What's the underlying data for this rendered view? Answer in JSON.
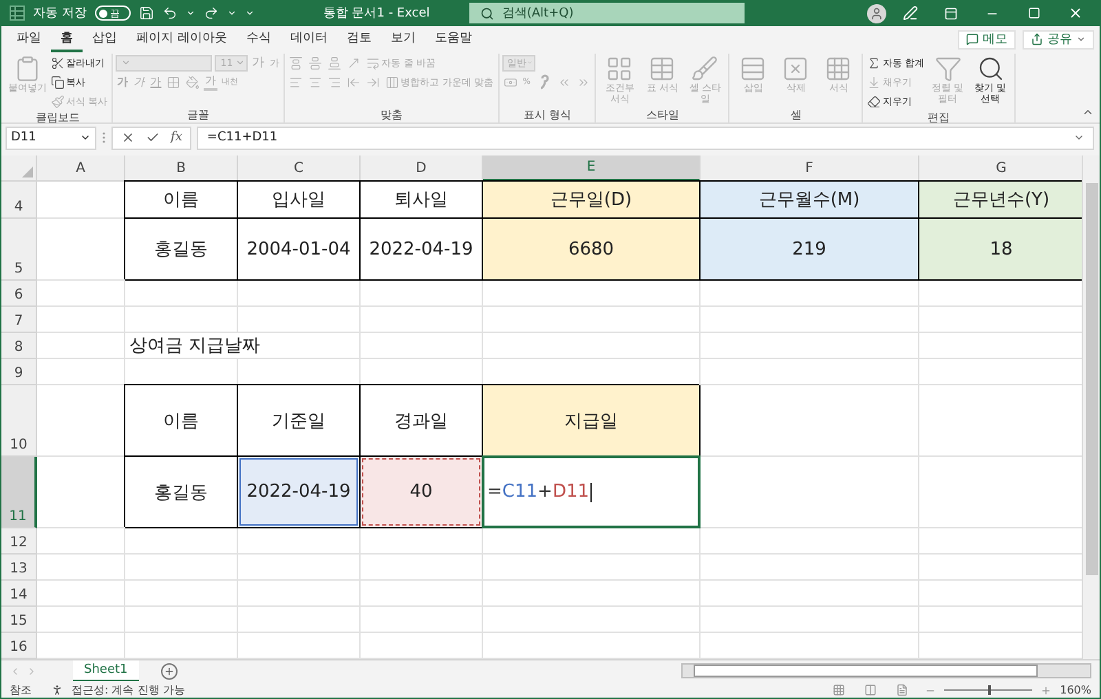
{
  "title_bar": {
    "autosave_label": "자동 저장",
    "autosave": {
      "on": false,
      "label": "끔"
    },
    "title": "통합 문서1  -  Excel",
    "search": {
      "placeholder": "검색(Alt+Q)"
    }
  },
  "ribbon_tabs": [
    {
      "label": "파일",
      "selected": false
    },
    {
      "label": "홈",
      "selected": true
    },
    {
      "label": "삽입",
      "selected": false
    },
    {
      "label": "페이지 레이아웃",
      "selected": false
    },
    {
      "label": "수식",
      "selected": false
    },
    {
      "label": "데이터",
      "selected": false
    },
    {
      "label": "검토",
      "selected": false
    },
    {
      "label": "보기",
      "selected": false
    },
    {
      "label": "도움말",
      "selected": false
    }
  ],
  "ribbon_actions": [
    {
      "label": "메모"
    },
    {
      "label": "공유"
    }
  ],
  "ribbon_groups": [
    {
      "label": "클립보드",
      "blocks": [
        {
          "kind": "large",
          "label": "붙여넣기",
          "disabled": true
        },
        {
          "kind": "stack",
          "lines": [
            [
              {
                "kind": "small",
                "label": "잘라내기",
                "disabled": false
              }
            ],
            [
              {
                "kind": "small",
                "label": "복사",
                "disabled": false
              }
            ],
            [
              {
                "kind": "small",
                "label": "서식 복사",
                "disabled": true
              }
            ]
          ]
        }
      ]
    },
    {
      "label": "글꼴",
      "blocks": [
        {
          "kind": "stack",
          "lines": [
            [
              {
                "kind": "combo",
                "disabled": true
              },
              {
                "kind": "combo",
                "label": "11",
                "disabled": true
              },
              {
                "kind": "grow",
                "label": "가",
                "disabled": true
              },
              {
                "kind": "shrink",
                "label": "가",
                "disabled": true
              }
            ],
            [
              {
                "kind": "bold",
                "label": "가",
                "disabled": true
              },
              {
                "kind": "italic",
                "label": "가",
                "disabled": true
              },
              {
                "kind": "underline",
                "label": "가",
                "disabled": true
              },
              {
                "kind": "small",
                "disabled": true
              },
              {
                "kind": "small",
                "disabled": true
              },
              {
                "kind": "font-color",
                "label": "가",
                "disabled": true
              },
              {
                "kind": "glyph",
                "label": "내천",
                "disabled": true
              }
            ]
          ]
        }
      ]
    },
    {
      "label": "맞춤",
      "blocks": [
        {
          "kind": "stack",
          "lines": [
            [
              {
                "kind": "small",
                "disabled": true
              },
              {
                "kind": "small",
                "disabled": true
              },
              {
                "kind": "small",
                "disabled": true
              },
              {
                "kind": "small",
                "disabled": true
              },
              {
                "kind": "small",
                "label": "자동 줄 바꿈",
                "disabled": true
              }
            ],
            [
              {
                "kind": "small",
                "disabled": true
              },
              {
                "kind": "small",
                "disabled": true
              },
              {
                "kind": "small",
                "disabled": true
              },
              {
                "kind": "small",
                "disabled": true
              },
              {
                "kind": "small",
                "disabled": true
              },
              {
                "kind": "small",
                "label": "병합하고 가운데 맞춤",
                "disabled": true
              }
            ]
          ]
        }
      ]
    },
    {
      "label": "표시 형식",
      "blocks": [
        {
          "kind": "stack",
          "lines": [
            [
              {
                "kind": "combo",
                "label": "일반",
                "disabled": true
              }
            ],
            [
              {
                "kind": "small",
                "disabled": true
              },
              {
                "kind": "glyph",
                "label": "%",
                "disabled": true
              },
              {
                "kind": "small",
                "disabled": true
              },
              {
                "kind": "small",
                "disabled": true
              },
              {
                "kind": "small",
                "disabled": true
              }
            ]
          ]
        }
      ]
    },
    {
      "label": "스타일",
      "blocks": [
        {
          "kind": "large",
          "label": "조건부 서식",
          "disabled": true
        },
        {
          "kind": "large",
          "label": "표 서식",
          "disabled": true
        },
        {
          "kind": "large",
          "label": "셀 스타일",
          "disabled": true
        }
      ]
    },
    {
      "label": "셀",
      "blocks": [
        {
          "kind": "large",
          "label": "삽입",
          "disabled": true
        },
        {
          "kind": "large",
          "label": "삭제",
          "disabled": true
        },
        {
          "kind": "large",
          "label": "서식",
          "disabled": true
        }
      ]
    },
    {
      "label": "편집",
      "blocks": [
        {
          "kind": "stack",
          "lines": [
            [
              {
                "kind": "small",
                "label": "자동 합계",
                "disabled": false
              }
            ],
            [
              {
                "kind": "small",
                "label": "채우기",
                "disabled": true
              }
            ],
            [
              {
                "kind": "small",
                "label": "지우기",
                "disabled": false
              }
            ]
          ]
        },
        {
          "kind": "large",
          "label": "정렬 및 필터",
          "disabled": true
        },
        {
          "kind": "large",
          "label": "찾기 및 선택",
          "disabled": false
        }
      ]
    }
  ],
  "formula_bar": {
    "name_box": "D11",
    "function_button": "fx",
    "formula": "=C11+D11"
  },
  "sheet": {
    "columns": [
      {
        "label": "A",
        "selected": false
      },
      {
        "label": "B",
        "selected": false
      },
      {
        "label": "C",
        "selected": false
      },
      {
        "label": "D",
        "selected": false
      },
      {
        "label": "E",
        "selected": true
      },
      {
        "label": "F",
        "selected": false
      },
      {
        "label": "G",
        "selected": false
      }
    ],
    "rows": [
      {
        "label": "4",
        "kind": "clipped",
        "selected": false,
        "cells": [
          {},
          {
            "text": "이름",
            "bordered": true
          },
          {
            "text": "입사일",
            "bordered": true
          },
          {
            "text": "퇴사일",
            "bordered": true
          },
          {
            "text": "근무일(D)",
            "bordered": true,
            "color": "#fff2cc"
          },
          {
            "text": "근무월수(M)",
            "bordered": true,
            "color": "#ddebf7"
          },
          {
            "text": "근무년수(Y)",
            "bordered": true,
            "color": "#e2efda"
          }
        ]
      },
      {
        "label": "5",
        "kind": "medium",
        "selected": false,
        "cells": [
          {},
          {
            "text": "홍길동",
            "bordered": true
          },
          {
            "text": "2004-01-04",
            "bordered": true
          },
          {
            "text": "2022-04-19",
            "bordered": true
          },
          {
            "text": "6680",
            "bordered": true,
            "color": "#fff2cc"
          },
          {
            "text": "219",
            "bordered": true,
            "color": "#ddebf7"
          },
          {
            "text": "18",
            "bordered": true,
            "color": "#e2efda"
          }
        ]
      },
      {
        "label": "6",
        "kind": "normal",
        "selected": false
      },
      {
        "label": "7",
        "kind": "normal",
        "selected": false
      },
      {
        "label": "8",
        "kind": "normal",
        "selected": false,
        "cells": [
          {},
          {
            "text": "상여금 지급날짜",
            "overflow": true
          },
          {},
          {},
          {},
          {},
          {}
        ]
      },
      {
        "label": "9",
        "kind": "normal",
        "selected": false
      },
      {
        "label": "10",
        "kind": "tall",
        "selected": false,
        "cells": [
          {},
          {
            "text": "이름",
            "bordered": true
          },
          {
            "text": "기준일",
            "bordered": true
          },
          {
            "text": "경과일",
            "bordered": true
          },
          {
            "text": "지급일",
            "bordered": true,
            "color": "#fff2cc"
          },
          {},
          {}
        ]
      },
      {
        "label": "11",
        "kind": "tall",
        "selected": true,
        "cells": [
          {},
          {
            "text": "홍길동",
            "bordered": true
          },
          {
            "text": "2022-04-19",
            "bordered": true,
            "color": "#e3ebf7",
            "reference": {
              "color": "#4472c4",
              "dashed": false
            }
          },
          {
            "text": "40",
            "bordered": true,
            "color": "#f8e6e6",
            "reference": {
              "color": "#c0504d",
              "dashed": true
            }
          },
          {
            "editing": true,
            "bordered": true,
            "parts": [
              {
                "text": "=",
                "color": "#333333"
              },
              {
                "text": "C11",
                "color": "#4472c4"
              },
              {
                "text": "+",
                "color": "#333333"
              },
              {
                "text": "D11",
                "color": "#c0504d"
              }
            ]
          },
          {},
          {}
        ]
      },
      {
        "label": "12",
        "kind": "normal",
        "selected": false
      },
      {
        "label": "13",
        "kind": "normal",
        "selected": false
      },
      {
        "label": "14",
        "kind": "normal",
        "selected": false
      },
      {
        "label": "15",
        "kind": "normal",
        "selected": false
      },
      {
        "label": "16",
        "kind": "normal",
        "selected": false
      }
    ]
  },
  "sheet_tabs": [
    {
      "label": "Sheet1",
      "selected": true
    }
  ],
  "status_bar": {
    "mode": "참조",
    "accessibility": "접근성: 계속 진행 가능",
    "zoom": {
      "level": 0.5,
      "label": "160%"
    }
  }
}
